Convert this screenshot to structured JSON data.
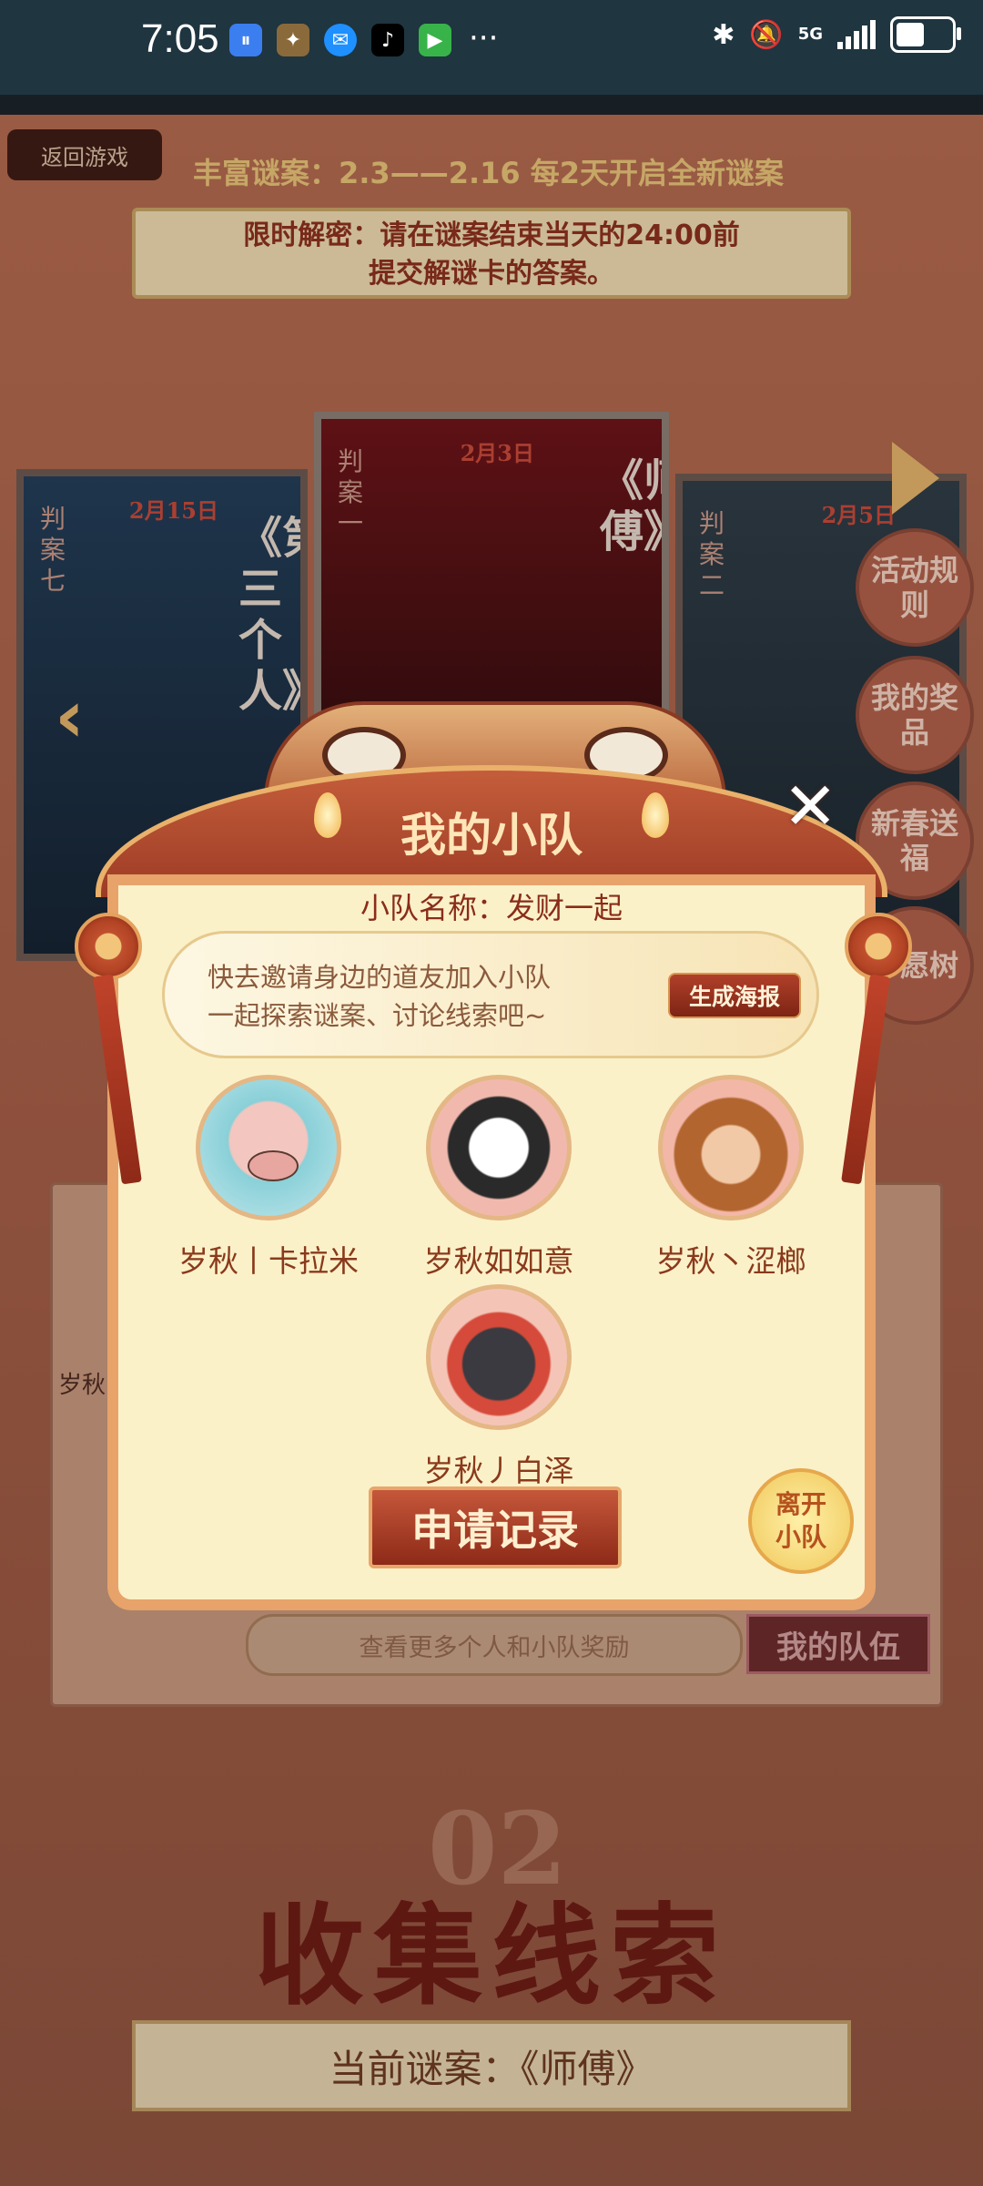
{
  "status_bar": {
    "time": "7:05",
    "network": "5G",
    "icons": [
      "app-icon-1",
      "game-app-icon",
      "message-icon",
      "tiktok-icon",
      "video-app-icon",
      "more-dots-icon",
      "bluetooth-icon",
      "mute-icon",
      "signal-icon",
      "battery-icon"
    ],
    "dots": "···"
  },
  "page": {
    "back_button": "返回游戏",
    "subtitle": "丰富谜案：2.3——2.16 每2天开启全新谜案",
    "notice_line1": "限时解密：请在谜案结束当天的24:00前",
    "notice_line2": "提交解谜卡的答案。",
    "cards": [
      {
        "case": "判案七",
        "date": "2月15日",
        "title": "《第三个人》"
      },
      {
        "case": "判案一",
        "date": "2月3日",
        "title": "《师傅》"
      },
      {
        "case": "判案二",
        "date": "2月5日",
        "title": ""
      }
    ],
    "side_buttons": [
      "活动规则",
      "我的奖品",
      "新春送福",
      "千愿树"
    ],
    "bg_label": "岁秋",
    "more_rewards": "查看更多个人和小队奖励",
    "my_team": "我的队伍",
    "section_number": "02",
    "section_title": "收集线索",
    "current_case": "当前谜案：《师傅》"
  },
  "modal": {
    "title": "我的小队",
    "team_name": "小队名称：发财一起",
    "invite_line1": "快去邀请身边的道友加入小队",
    "invite_line2": "一起探索谜案、讨论线索吧~",
    "poster_button": "生成海报",
    "members": [
      {
        "name": "岁秋丨卡拉米",
        "avatar": "pig-avatar"
      },
      {
        "name": "岁秋如如意",
        "avatar": "panda-avatar"
      },
      {
        "name": "岁秋丶涩榔",
        "avatar": "monkey-avatar"
      },
      {
        "name": "岁秋丿白泽",
        "avatar": "crow-avatar"
      }
    ],
    "apply_button": "申请记录",
    "leave_button_line1": "离开",
    "leave_button_line2": "小队",
    "close_icon": "close-icon"
  },
  "colors": {
    "accent": "#b0402a",
    "panel": "#fbf1c9",
    "gold": "#e9b16a"
  }
}
